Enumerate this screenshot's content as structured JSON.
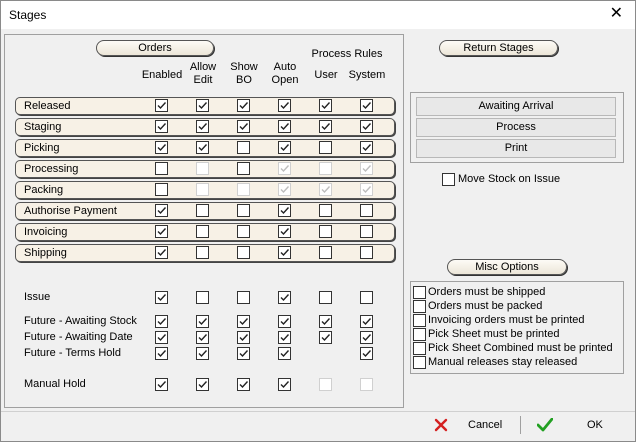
{
  "window": {
    "title": "Stages"
  },
  "orders": {
    "header": "Orders",
    "columns": [
      [
        "Enabled"
      ],
      [
        "Allow",
        "Edit"
      ],
      [
        "Show",
        "BO"
      ],
      [
        "Auto",
        "Open"
      ],
      [
        "User"
      ],
      [
        "System"
      ]
    ],
    "process_rules_label": "Process Rules",
    "stages": [
      {
        "label": "Released",
        "checks": [
          "on",
          "on",
          "on",
          "on",
          "on",
          "on"
        ]
      },
      {
        "label": "Staging",
        "checks": [
          "on",
          "on",
          "on",
          "on",
          "on",
          "on"
        ]
      },
      {
        "label": "Picking",
        "checks": [
          "on",
          "on",
          "off",
          "on",
          "off",
          "on"
        ]
      },
      {
        "label": "Processing",
        "checks": [
          "off",
          "dis",
          "off",
          "dis-on",
          "dis",
          "dis-on"
        ]
      },
      {
        "label": "Packing",
        "checks": [
          "off",
          "dis",
          "dis",
          "dis-on",
          "dis-on",
          "dis-on"
        ]
      },
      {
        "label": "Authorise Payment",
        "checks": [
          "on",
          "off",
          "off",
          "on",
          "off",
          "off"
        ]
      },
      {
        "label": "Invoicing",
        "checks": [
          "on",
          "off",
          "off",
          "on",
          "off",
          "off"
        ]
      },
      {
        "label": "Shipping",
        "checks": [
          "on",
          "off",
          "off",
          "on",
          "off",
          "off"
        ]
      }
    ],
    "other_rows": [
      {
        "label": "Issue",
        "checks": [
          "on",
          "off",
          "off",
          "on",
          "off",
          "off"
        ]
      },
      {
        "label": "Future - Awaiting Stock",
        "checks": [
          "on",
          "on",
          "on",
          "on",
          "on",
          "on"
        ]
      },
      {
        "label": "Future - Awaiting Date",
        "checks": [
          "on",
          "on",
          "on",
          "on",
          "on",
          "on"
        ]
      },
      {
        "label": "Future - Terms Hold",
        "checks": [
          "on",
          "on",
          "on",
          "on",
          "none",
          "on"
        ]
      },
      {
        "label": "Manual Hold",
        "checks": [
          "on",
          "on",
          "on",
          "on",
          "dis",
          "dis"
        ]
      }
    ]
  },
  "return_stages": {
    "header": "Return Stages",
    "buttons": [
      "Awaiting Arrival",
      "Process",
      "Print"
    ],
    "move_stock_label": "Move Stock on Issue"
  },
  "misc_options": {
    "header": "Misc Options",
    "items": [
      "Orders must be shipped",
      "Orders must be packed",
      "Invoicing orders must be printed",
      "Pick Sheet must be printed",
      "Pick Sheet Combined must be printed",
      "Manual releases stay released"
    ]
  },
  "footer": {
    "cancel_label": "Cancel",
    "ok_label": "OK"
  },
  "colors": {
    "pill_bg": "#f7f1e6",
    "cancel_icon": "#d42020",
    "ok_icon": "#22a022"
  }
}
